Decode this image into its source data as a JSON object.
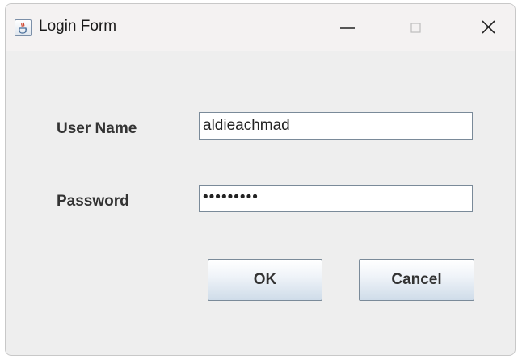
{
  "window": {
    "title": "Login Form",
    "app_icon": "java-cup-icon",
    "controls": [
      "minimize-icon",
      "maximize-icon",
      "close-icon"
    ]
  },
  "form": {
    "username_label": "User Name",
    "username_value": "aldieachmad",
    "password_label": "Password",
    "password_masked": "•••••••••"
  },
  "buttons": {
    "ok_label": "OK",
    "cancel_label": "Cancel"
  },
  "colors": {
    "window_bg": "#eeeeee",
    "titlebar_bg": "#f4f2f2",
    "field_border": "#7a8a99",
    "button_gradient_bottom": "#cfdce9",
    "label_text": "#333333"
  }
}
